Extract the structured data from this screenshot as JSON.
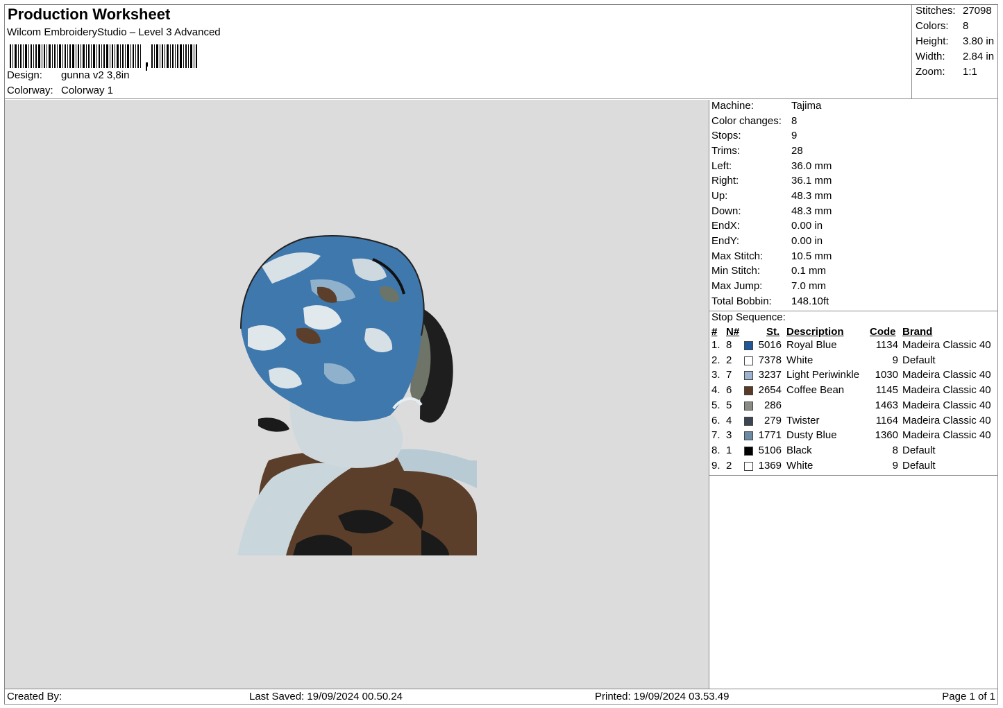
{
  "header": {
    "title": "Production Worksheet",
    "software": "Wilcom EmbroideryStudio – Level 3 Advanced",
    "design_label": "Design:",
    "design_value": "gunna v2 3,8in",
    "colorway_label": "Colorway:",
    "colorway_value": "Colorway 1"
  },
  "summary": [
    {
      "label": "Stitches:",
      "value": "27098"
    },
    {
      "label": "Colors:",
      "value": "8"
    },
    {
      "label": "Height:",
      "value": "3.80 in"
    },
    {
      "label": "Width:",
      "value": "2.84 in"
    },
    {
      "label": "Zoom:",
      "value": "1:1"
    }
  ],
  "machine_info": [
    {
      "label": "Machine:",
      "value": "Tajima"
    },
    {
      "label": "Color changes:",
      "value": "8"
    },
    {
      "label": "Stops:",
      "value": "9"
    },
    {
      "label": "Trims:",
      "value": "28"
    },
    {
      "label": "Left:",
      "value": "36.0 mm"
    },
    {
      "label": "Right:",
      "value": "36.1 mm"
    },
    {
      "label": "Up:",
      "value": "48.3 mm"
    },
    {
      "label": "Down:",
      "value": "48.3 mm"
    },
    {
      "label": "EndX:",
      "value": "0.00 in"
    },
    {
      "label": "EndY:",
      "value": "0.00 in"
    },
    {
      "label": "Max Stitch:",
      "value": "10.5 mm"
    },
    {
      "label": "Min Stitch:",
      "value": "0.1 mm"
    },
    {
      "label": "Max Jump:",
      "value": "7.0 mm"
    },
    {
      "label": "Total Bobbin:",
      "value": "148.10ft"
    }
  ],
  "stop_sequence": {
    "title": "Stop Sequence:",
    "headers": {
      "num": "#",
      "n": "N#",
      "st": "St.",
      "desc": "Description",
      "code": "Code",
      "brand": "Brand"
    },
    "rows": [
      {
        "num": "1.",
        "n": "8",
        "color": "#1f5799",
        "st": "5016",
        "desc": "Royal Blue",
        "code": "1134",
        "brand": "Madeira Classic 40"
      },
      {
        "num": "2.",
        "n": "2",
        "color": "#ffffff",
        "st": "7378",
        "desc": "White",
        "code": "9",
        "brand": "Default"
      },
      {
        "num": "3.",
        "n": "7",
        "color": "#9db3d1",
        "st": "3237",
        "desc": "Light Periwinkle",
        "code": "1030",
        "brand": "Madeira Classic 40"
      },
      {
        "num": "4.",
        "n": "6",
        "color": "#5a3a26",
        "st": "2654",
        "desc": "Coffee Bean",
        "code": "1145",
        "brand": "Madeira Classic 40"
      },
      {
        "num": "5.",
        "n": "5",
        "color": "#8a8b82",
        "st": "286",
        "desc": "",
        "code": "1463",
        "brand": "Madeira Classic 40"
      },
      {
        "num": "6.",
        "n": "4",
        "color": "#3c4652",
        "st": "279",
        "desc": "Twister",
        "code": "1164",
        "brand": "Madeira Classic 40"
      },
      {
        "num": "7.",
        "n": "3",
        "color": "#6c8aa4",
        "st": "1771",
        "desc": "Dusty Blue",
        "code": "1360",
        "brand": "Madeira Classic 40"
      },
      {
        "num": "8.",
        "n": "1",
        "color": "#000000",
        "st": "5106",
        "desc": "Black",
        "code": "8",
        "brand": "Default"
      },
      {
        "num": "9.",
        "n": "2",
        "color": "#ffffff",
        "st": "1369",
        "desc": "White",
        "code": "9",
        "brand": "Default"
      }
    ]
  },
  "footer": {
    "created_by": "Created By:",
    "last_saved": "Last Saved: 19/09/2024 00.50.24",
    "printed": "Printed: 19/09/2024 03.53.49",
    "page": "Page 1 of 1"
  }
}
